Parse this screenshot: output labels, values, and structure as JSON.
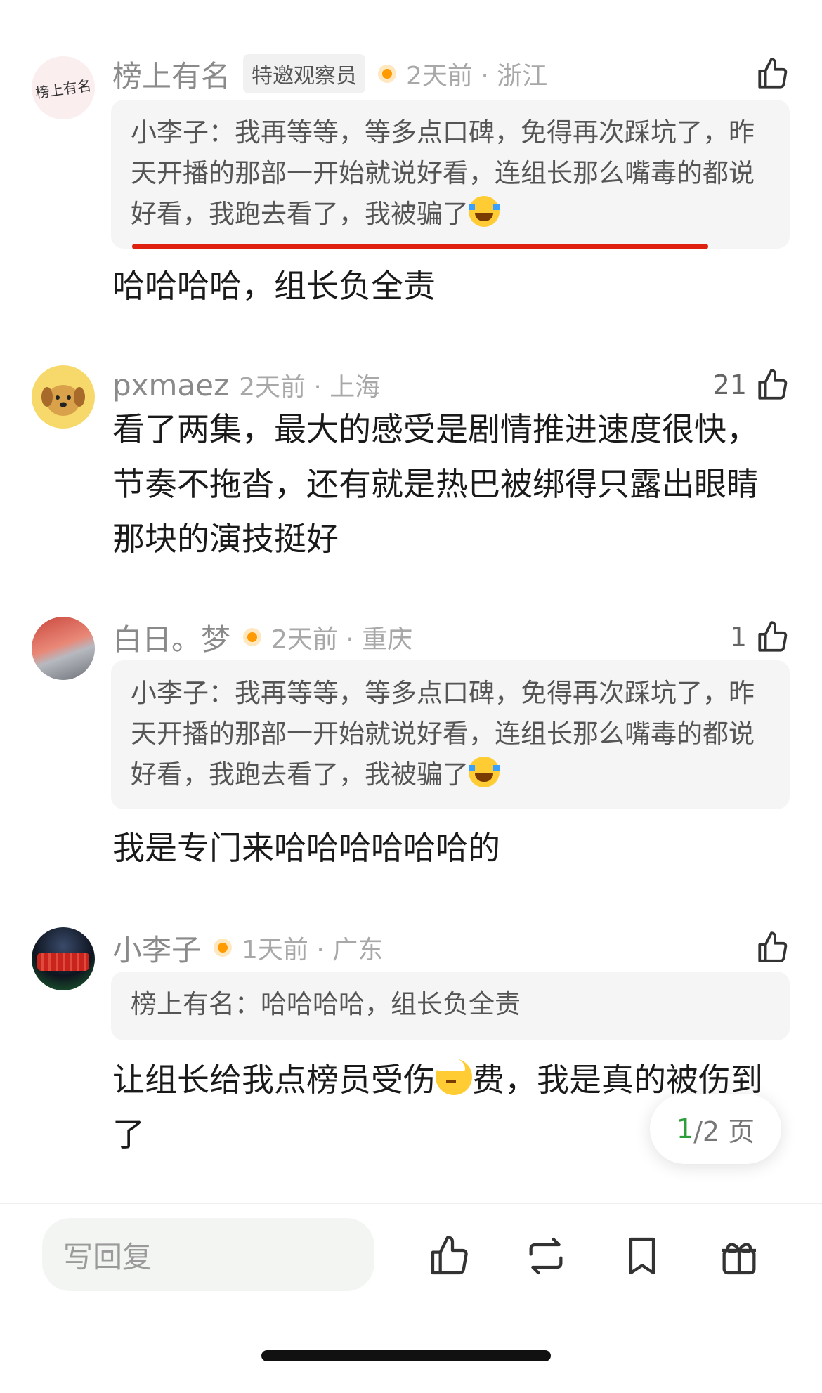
{
  "comments": [
    {
      "name": "榜上有名",
      "badge": "特邀观察员",
      "time": "2天前 · 浙江",
      "likes": "",
      "quote": "小李子：我再等等，等多点口碑，免得再次踩坑了，昨天开播的那部一开始就说好看，连组长那么嘴毒的都说好看，我跑去看了，我被骗了",
      "text": "哈哈哈哈，组长负全责",
      "avatar_text": "榜上有名"
    },
    {
      "name": "pxmaez",
      "time": "2天前 · 上海",
      "likes": "21",
      "text": "看了两集，最大的感受是剧情推进速度很快，节奏不拖沓，还有就是热巴被绑得只露出眼睛那块的演技挺好"
    },
    {
      "name": "白日。梦",
      "time": "2天前 · 重庆",
      "likes": "1",
      "quote": "小李子：我再等等，等多点口碑，免得再次踩坑了，昨天开播的那部一开始就说好看，连组长那么嘴毒的都说好看，我跑去看了，我被骗了",
      "text": "我是专门来哈哈哈哈哈哈的"
    },
    {
      "name": "小李子",
      "time": "1天前 · 广东",
      "likes": "",
      "quote": "榜上有名：哈哈哈哈，组长负全责",
      "text_a": "让组长给我点榜员受伤",
      "text_b": "费，我是真的被伤到了"
    }
  ],
  "pager": {
    "current": "1",
    "rest": "/2 页"
  },
  "bottom_bar": {
    "reply_placeholder": "写回复"
  },
  "icons": [
    "thumb-up-icon",
    "repost-icon",
    "bookmark-icon",
    "gift-icon",
    "laugh-cry-emoji",
    "injured-emoji"
  ],
  "colors": {
    "accent_green": "#2e9e3a",
    "underline_red": "#e0200f",
    "badge_dot": "#ff9a00"
  }
}
